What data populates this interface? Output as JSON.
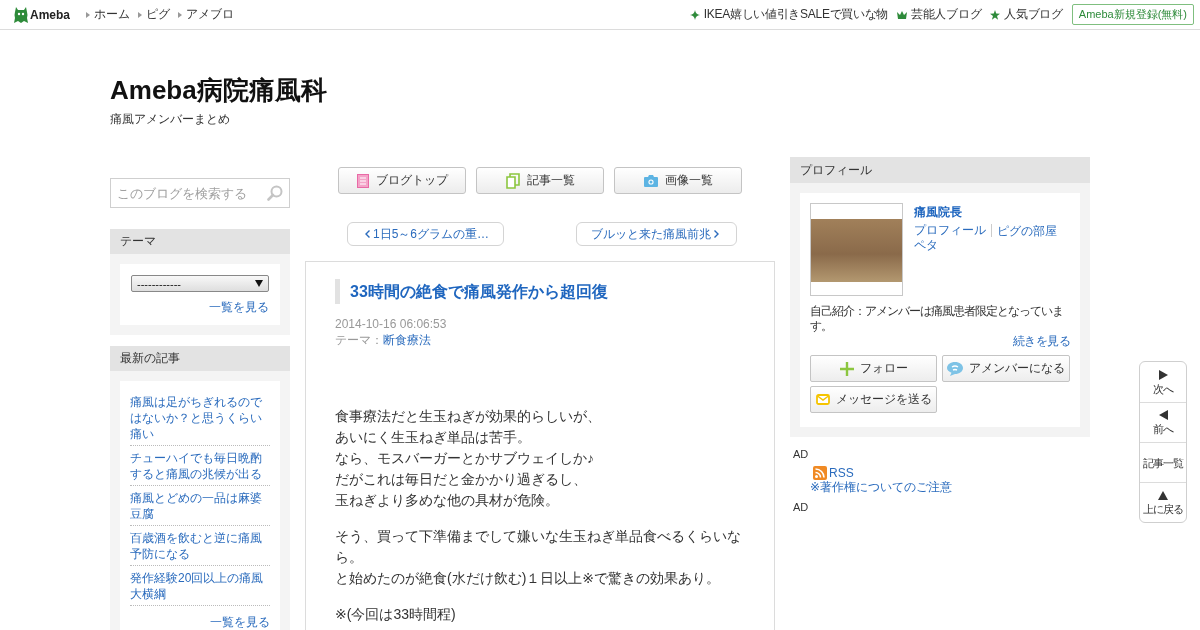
{
  "topbar": {
    "logo": "Ameba",
    "nav": [
      "ホーム",
      "ピグ",
      "アメブロ"
    ],
    "links": [
      {
        "kind": "sparkle",
        "label": "IKEA嬉しい値引きSALEで買いな物"
      },
      {
        "kind": "crown",
        "label": "芸能人ブログ"
      },
      {
        "kind": "star",
        "label": "人気ブログ"
      }
    ],
    "register": "Ameba新規登録(無料)"
  },
  "blog": {
    "title": "Ameba病院痛風科",
    "subtitle": "痛風アメンバーまとめ"
  },
  "sidebar": {
    "search": {
      "placeholder": "このブログを検索する"
    },
    "theme": {
      "heading": "テーマ",
      "select": "------------",
      "more": "一覧を見る"
    },
    "recent": {
      "heading": "最新の記事",
      "items": [
        "痛風は足がちぎれるのではないか？と思うくらい痛い",
        "チューハイでも毎日晩酌すると痛風の兆候が出る",
        "痛風とどめの一品は麻婆豆腐",
        "百歳酒を飲むと逆に痛風予防になる",
        "発作経験20回以上の痛風大横綱"
      ],
      "more": "一覧を見る"
    }
  },
  "toolbar": [
    {
      "kind": "top",
      "label": "ブログトップ"
    },
    {
      "kind": "articles",
      "label": "記事一覧"
    },
    {
      "kind": "images",
      "label": "画像一覧"
    }
  ],
  "pager": {
    "prev": "1日5～6グラムの重…",
    "next": "ブルッと来た痛風前兆"
  },
  "article": {
    "title": "33時間の絶食で痛風発作から超回復",
    "date": "2014-10-16 06:06:53",
    "theme_label": "テーマ：",
    "theme": "断食療法",
    "paragraphs": [
      [
        "食事療法だと生玉ねぎが効果的らしいが、",
        "あいにく生玉ねぎ単品は苦手。",
        "なら、モスバーガーとかサブウェイしか♪",
        "だがこれは毎日だと金かかり過ぎるし、",
        "玉ねぎより多めな他の具材が危険。"
      ],
      [
        "そう、買って下準備までして嫌いな生玉ねぎ単品食べるくらいなら。",
        "と始めたのが絶食(水だけ飲む)１日以上※で驚きの効果あり。"
      ],
      [
        "※(今回は33時間程)"
      ]
    ]
  },
  "profile": {
    "heading": "プロフィール",
    "name": "痛風院長",
    "links": [
      [
        "プロフィール",
        "ピグの部屋"
      ],
      [
        "ペタ"
      ]
    ],
    "intro": "自己紹介：アメンバーは痛風患者限定となっています。",
    "more": "続きを見る",
    "buttons": [
      {
        "kind": "follow",
        "label": "フォロー"
      },
      {
        "kind": "amember",
        "label": "アメンバーになる"
      },
      {
        "kind": "message",
        "label": "メッセージを送る"
      }
    ]
  },
  "extras": {
    "ad_top": "AD",
    "rss": "RSS",
    "copyright": "※著作権についてのご注意",
    "ad_bottom": "AD"
  },
  "float_nav": [
    {
      "kind": "next",
      "label": "次へ"
    },
    {
      "kind": "prev",
      "label": "前へ"
    },
    {
      "kind": "list",
      "label": "記事一覧"
    },
    {
      "kind": "top",
      "label": "上に戻る"
    }
  ]
}
